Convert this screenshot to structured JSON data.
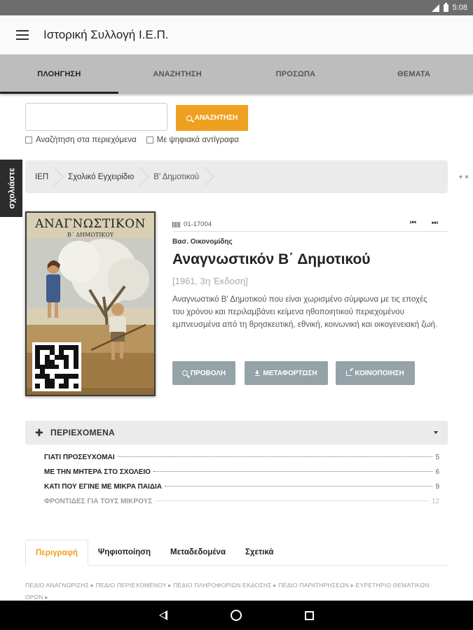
{
  "status": {
    "time": "5:08"
  },
  "app": {
    "title": "Ιστορική Συλλογή Ι.Ε.Π."
  },
  "tabs": [
    {
      "label": "ΠΛΟΗΓΗΣΗ"
    },
    {
      "label": "ΑΝΑΖΗΤΗΣΗ"
    },
    {
      "label": "ΠΡΟΣΩΠΑ"
    },
    {
      "label": "ΘΕΜΑΤΑ"
    }
  ],
  "feedback": {
    "label": "σχολιάστε"
  },
  "search": {
    "value": "",
    "button_label": "ΑΝΑΖΗΤΗΣΗ",
    "checkbox_contents": "Αναζήτηση στα περιεχόμενα",
    "checkbox_digital": "Με ψηφιακά αντίγραφα"
  },
  "breadcrumb": [
    {
      "label": "ΙΕΠ"
    },
    {
      "label": "Σχολικό Εγχειρίδιο"
    },
    {
      "label": "Β' Δημοτικού"
    }
  ],
  "breadcrumb_extra": "+ ×",
  "cover": {
    "title": "ΑΝΑΓΝΩΣΤΙΚΟΝ",
    "subtitle": "Β΄ ΔΗΜΟΤΙΚΟΥ"
  },
  "book": {
    "code": "01-17004",
    "prev_icon": "⏮",
    "next_icon": "⏭",
    "author": "Βασ. Οικονομίδης",
    "title": "Αναγνωστικόν Β΄ Δημοτικού",
    "edition": "[1961, 3η Έκδοση]",
    "description": "Αναγνωστικό Β' Δημοτικού που είναι χωρισμένο σύμφωνα με τις εποχές του χρόνου και περιλαμβάνει κείμενα ηθοποιητικού περιεχομένου εμπνευσμένα από τη θρησκευτική, εθνική, κοινωνική και οικογενειακή ζωή."
  },
  "actions": {
    "view": "ΠΡΟΒΟΛΗ",
    "download": "ΜΕΤΑΦΟΡΤΩΣΗ",
    "share": "ΚΟΙΝΟΠΟΙΗΣΗ"
  },
  "contents": {
    "title": "ΠΕΡΙΕΧΟΜΕΝΑ",
    "items": [
      {
        "title": "ΓΙΑΤΙ ΠΡΟΣΕΥΧΟΜΑΙ",
        "page": "5"
      },
      {
        "title": "ΜΕ ΤΗΝ ΜΗΤΕΡΑ ΣΤΟ ΣΧΟΛΕΙΟ",
        "page": "6"
      },
      {
        "title": "ΚΑΤΙ ΠΟΥ ΕΓΙΝΕ ΜΕ ΜΙΚΡΑ ΠΑΙΔΙΑ",
        "page": "9"
      },
      {
        "title": "ΦΡΟΝΤΙΔΕΣ ΓΙΑ ΤΟΥΣ ΜΙΚΡΟΥΣ",
        "page": "12"
      }
    ]
  },
  "info_tabs": [
    {
      "label": "Περιγραφή"
    },
    {
      "label": "Ψηφιοποίηση"
    },
    {
      "label": "Μεταδεδομένα"
    },
    {
      "label": "Σχετικά"
    }
  ],
  "links": "ΠΕΔΙΟ ΑΝΑΓΝΩΡΙΣΗΣ ▸  ΠΕΔΙΟ ΠΕΡΙΕΧΟΜΕΝΟΥ ▸  ΠΕΔΙΟ ΠΛΗΡΟΦΟΡΙΩΝ ΕΚΔΟΣΗΣ ▸  ΠΕΔΙΟ ΠΑΡΑΤΗΡΗΣΕΩΝ ▸  ΕΥΡΕΤΗΡΙΟ ΘΕΜΑΤΙΚΩΝ ΟΡΩΝ ▸",
  "colors": {
    "accent": "#f0a020",
    "tabbar": "#bdbdbd",
    "action_button": "#95a3a8"
  }
}
